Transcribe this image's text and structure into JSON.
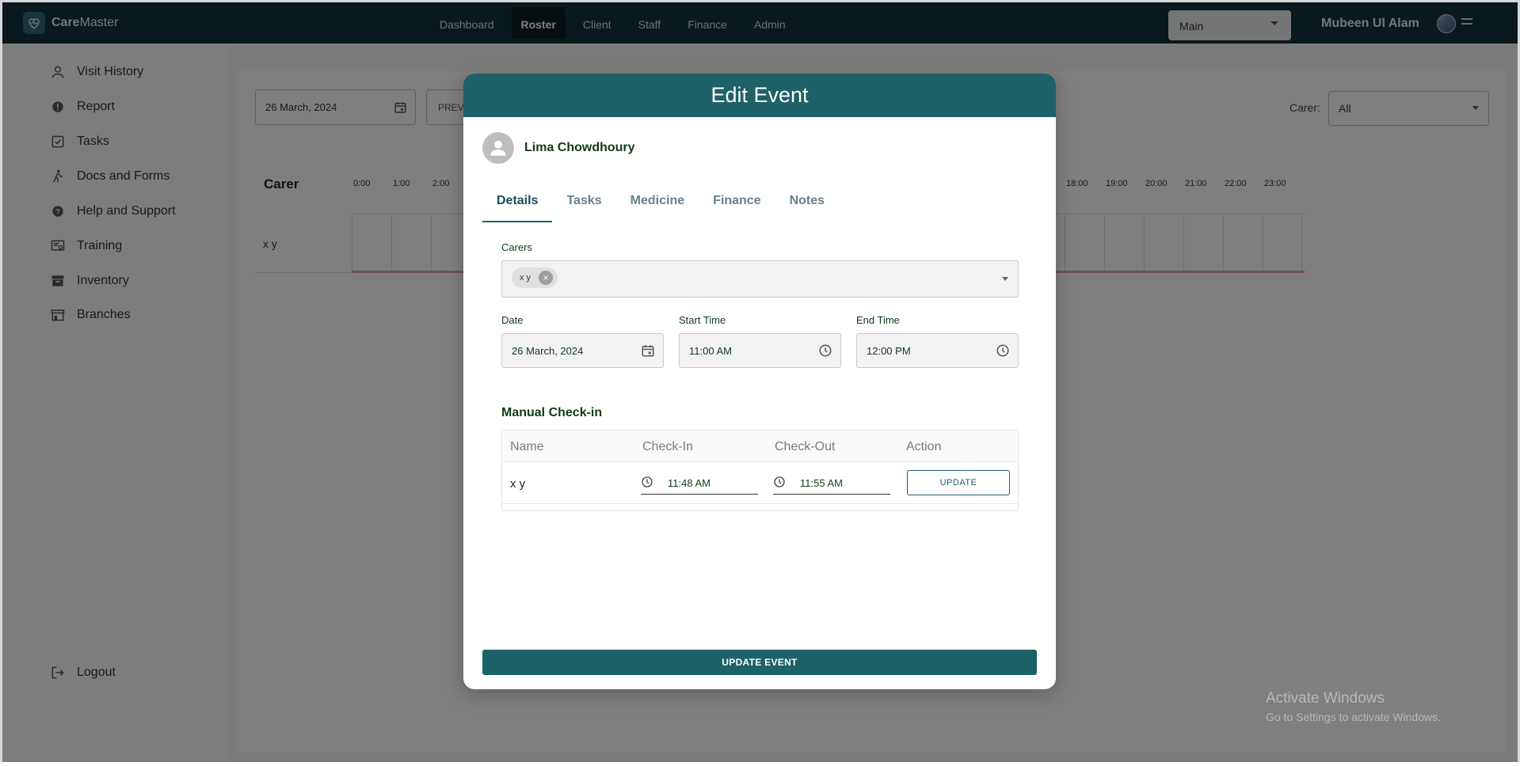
{
  "app": {
    "brand_bold": "Care",
    "brand_rest": "Master"
  },
  "nav": {
    "items": [
      "Dashboard",
      "Roster",
      "Client",
      "Staff",
      "Finance",
      "Admin"
    ],
    "active": "Roster"
  },
  "header": {
    "branch_select": "Main",
    "user_name": "Mubeen Ul Alam"
  },
  "sidebar": {
    "items": [
      {
        "label": "Visit History",
        "icon": "person-icon"
      },
      {
        "label": "Report",
        "icon": "alert-icon"
      },
      {
        "label": "Tasks",
        "icon": "checkbox-icon"
      },
      {
        "label": "Docs and Forms",
        "icon": "walking-person-icon"
      },
      {
        "label": "Help and Support",
        "icon": "help-icon"
      },
      {
        "label": "Training",
        "icon": "training-icon"
      },
      {
        "label": "Inventory",
        "icon": "archive-icon"
      },
      {
        "label": "Branches",
        "icon": "store-icon"
      }
    ],
    "logout": "Logout"
  },
  "roster": {
    "date": "26 March, 2024",
    "prev_button": "PREV",
    "carer_filter_label": "Carer:",
    "carer_filter_value": "All",
    "grid_title": "Carer",
    "hours_visible_left": [
      "0:00",
      "1:00",
      "2:00"
    ],
    "hours_visible_right": [
      "18:00",
      "19:00",
      "20:00",
      "21:00",
      "22:00",
      "23:00"
    ],
    "rows": [
      {
        "label": "x y"
      }
    ]
  },
  "watermark": {
    "line1": "Activate Windows",
    "line2": "Go to Settings to activate Windows."
  },
  "modal": {
    "title": "Edit Event",
    "client_name": "Lima Chowdhoury",
    "tabs": [
      "Details",
      "Tasks",
      "Medicine",
      "Finance",
      "Notes"
    ],
    "active_tab": "Details",
    "carers_label": "Carers",
    "carers_chips": [
      "x y"
    ],
    "date_label": "Date",
    "date_value": "26 March, 2024",
    "start_time_label": "Start Time",
    "start_time_value": "11:00 AM",
    "end_time_label": "End Time",
    "end_time_value": "12:00 PM",
    "manual_checkin_title": "Manual Check-in",
    "table": {
      "headers": [
        "Name",
        "Check-In",
        "Check-Out",
        "Action"
      ],
      "rows": [
        {
          "name": "x y",
          "check_in": "11:48 AM",
          "check_out": "11:55 AM",
          "action": "UPDATE"
        }
      ]
    },
    "submit_label": "UPDATE EVENT"
  },
  "colors": {
    "primary": "#1e6168",
    "topbar": "#14323a",
    "overlay": "rgba(0,0,0,0.5)"
  }
}
